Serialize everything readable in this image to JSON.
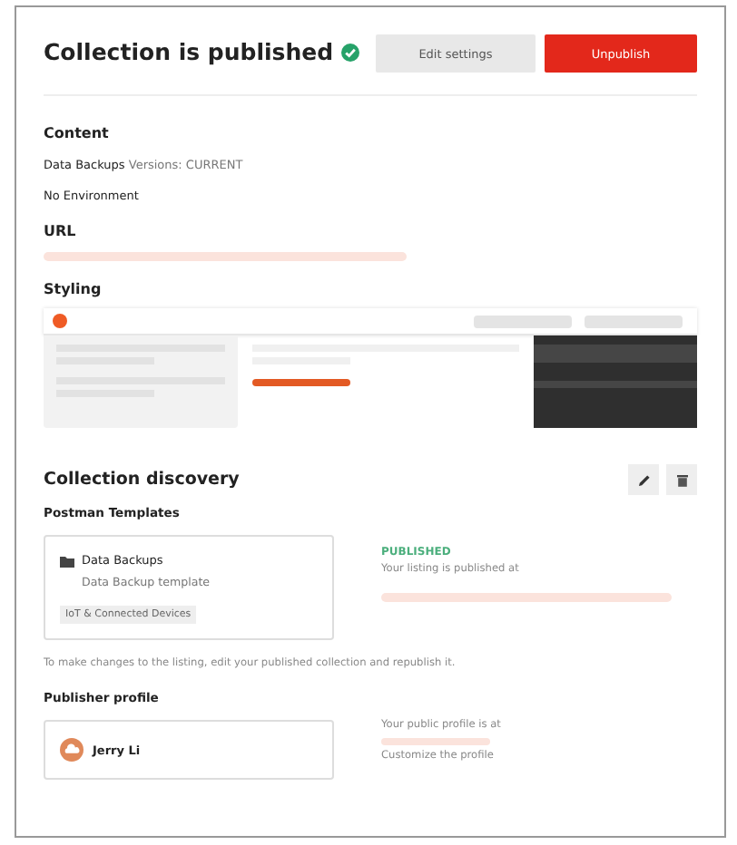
{
  "header": {
    "title": "Collection is published",
    "verified": true,
    "buttons": [
      {
        "label": "Edit settings",
        "kind": "secondary"
      },
      {
        "label": "Unpublish",
        "kind": "danger"
      }
    ]
  },
  "content": {
    "heading": "Content",
    "collection": "Data Backups",
    "version": "Versions: CURRENT",
    "environment": "No Environment"
  },
  "url": {
    "heading": "URL"
  },
  "styling": {
    "heading": "Styling"
  },
  "discovery": {
    "heading": "Collection discovery",
    "subheading": "Postman Templates",
    "listing": {
      "name": "Data Backups",
      "description": "Data Backup template",
      "tag": "IoT & Connected Devices"
    },
    "status": "PUBLISHED",
    "status_text": "Your listing is published at",
    "note": "To make changes to the listing, edit your published collection and republish it."
  },
  "publisher": {
    "heading": "Publisher profile",
    "name": "Jerry Li",
    "profile_text": "Your public profile is at",
    "customize_text": "Customize the profile"
  }
}
